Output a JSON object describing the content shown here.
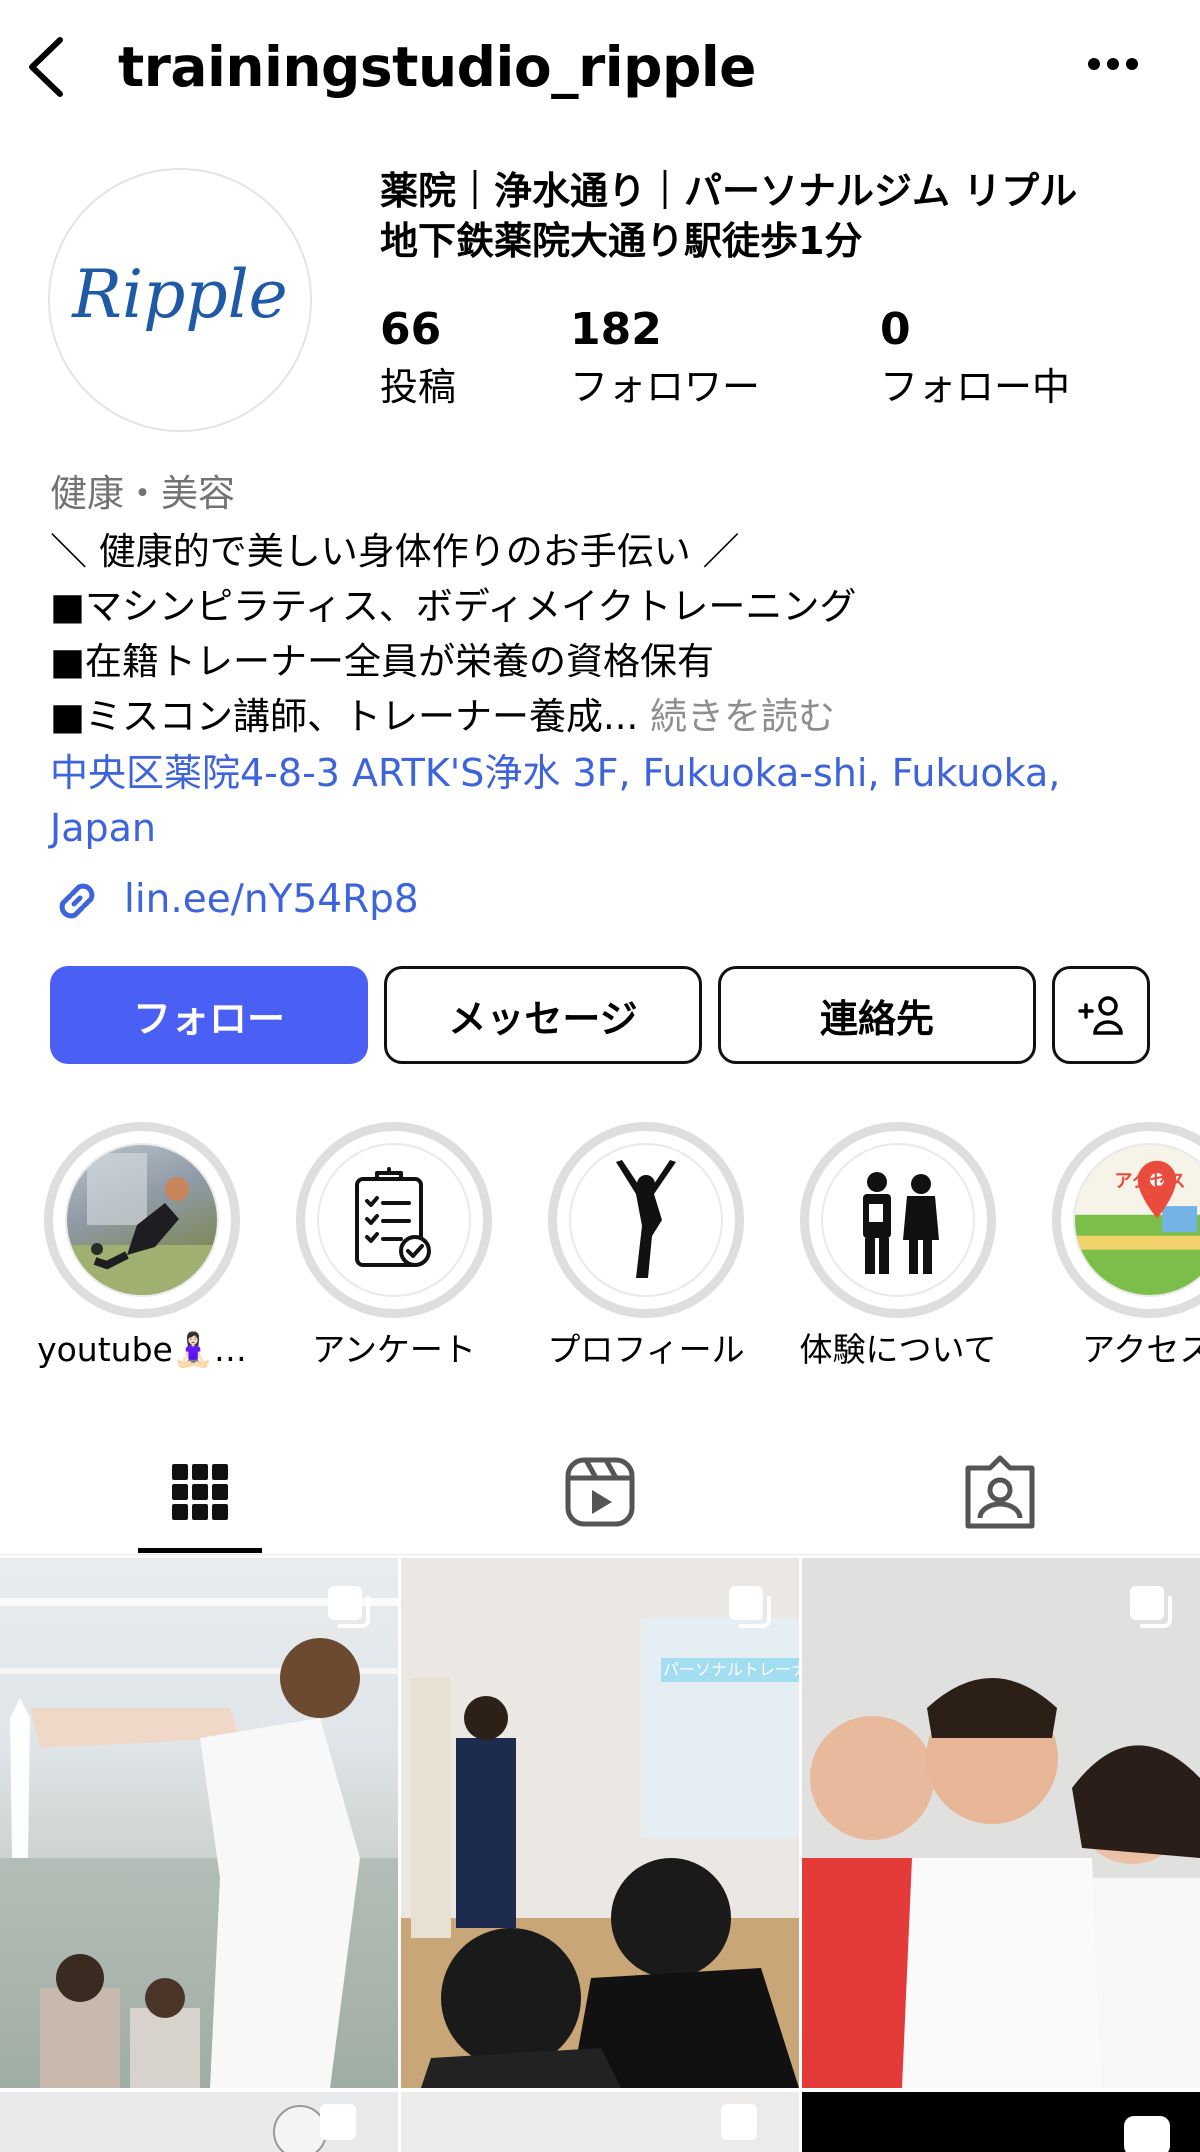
{
  "header": {
    "username": "trainingstudio_ripple"
  },
  "profile": {
    "avatar_text": "Ripple",
    "name_line1": "薬院｜浄水通り｜パーソナルジム リプル",
    "name_line2": "地下鉄薬院大通り駅徒歩1分",
    "stats": {
      "posts_count": "66",
      "posts_label": "投稿",
      "followers_count": "182",
      "followers_label": "フォロワー",
      "following_count": "0",
      "following_label": "フォロー中"
    },
    "category": "健康・美容",
    "bio": [
      "＼ 健康的で美しい身体作りのお手伝い ／",
      "■マシンピラティス、ボディメイクトレーニング",
      "■在籍トレーナー全員が栄養の資格保有",
      "■ミスコン講師、トレーナー養成..."
    ],
    "bio_more": " 続きを読む",
    "location": "中央区薬院4-8-3 ARTK'S浄水 3F, Fukuoka-shi, Fukuoka, Japan",
    "link": "lin.ee/nY54Rp8"
  },
  "buttons": {
    "follow": "フォロー",
    "message": "メッセージ",
    "contact": "連絡先"
  },
  "highlights": [
    {
      "label": "youtube🧘🏻‍♀️…",
      "icon": "yoga-photo"
    },
    {
      "label": "アンケート",
      "icon": "clipboard-checklist-icon"
    },
    {
      "label": "プロフィール",
      "icon": "person-pose-icon"
    },
    {
      "label": "体験について",
      "icon": "two-people-icon"
    },
    {
      "label": "アクセス",
      "icon": "map-pin-icon",
      "badge": "アクセス"
    }
  ],
  "tabs": [
    {
      "name": "posts-grid",
      "icon": "grid-icon",
      "active": true
    },
    {
      "name": "reels",
      "icon": "reels-icon",
      "active": false
    },
    {
      "name": "tagged",
      "icon": "tagged-person-icon",
      "active": false
    }
  ],
  "posts": [
    {
      "description": "trainer-seminar-office"
    },
    {
      "description": "lecture-presentation",
      "slide_title": "パーソナルトレーナ"
    },
    {
      "description": "group-selfie"
    }
  ],
  "colors": {
    "accent_blue": "#4a5ff3",
    "link_blue": "#3d63dd",
    "muted_gray": "#737373"
  }
}
